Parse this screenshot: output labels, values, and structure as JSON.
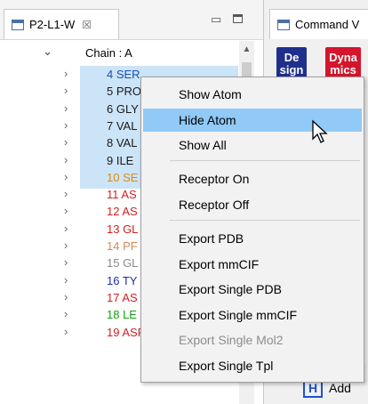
{
  "left_tab": {
    "title": "P2-L1-W",
    "close": "☒"
  },
  "right_tab": {
    "title": "Command V"
  },
  "tree": {
    "chain": "Chain : A",
    "residues": [
      {
        "label": "4 SER",
        "color": "#1a4fb0"
      },
      {
        "label": "5 PRO",
        "color": "#1a1a1a"
      },
      {
        "label": "6 GLY",
        "color": "#1a1a1a"
      },
      {
        "label": "7 VAL",
        "color": "#1a1a1a"
      },
      {
        "label": "8 VAL",
        "color": "#1a1a1a"
      },
      {
        "label": "9 ILE",
        "color": "#1a1a1a"
      },
      {
        "label": "10 SE",
        "color": "#e08a00"
      },
      {
        "label": "11 AS",
        "color": "#d42020"
      },
      {
        "label": "12 AS",
        "color": "#d42020"
      },
      {
        "label": "13 GL",
        "color": "#d42020"
      },
      {
        "label": "14 PF",
        "color": "#d28a55"
      },
      {
        "label": "15 GL",
        "color": "#8a8a8a"
      },
      {
        "label": "16 TY",
        "color": "#2030a0"
      },
      {
        "label": "17 AS",
        "color": "#d42020"
      },
      {
        "label": "18 LE",
        "color": "#16a016"
      },
      {
        "label": "19 ASP",
        "color": "#d42020"
      }
    ]
  },
  "buttons": {
    "design": "De sign",
    "dynamics": "Dyna mics"
  },
  "add_row": {
    "icon": "H",
    "label": "Add"
  },
  "context_menu": {
    "items": [
      {
        "label": "Show Atom",
        "state": "normal"
      },
      {
        "label": "Hide Atom",
        "state": "hover"
      },
      {
        "label": "Show All",
        "state": "normal"
      },
      {
        "label": "Receptor On",
        "state": "normal"
      },
      {
        "label": "Receptor Off",
        "state": "normal"
      },
      {
        "label": "Export PDB",
        "state": "normal"
      },
      {
        "label": "Export mmCIF",
        "state": "normal"
      },
      {
        "label": "Export Single PDB",
        "state": "normal"
      },
      {
        "label": "Export Single mmCIF",
        "state": "normal"
      },
      {
        "label": "Export Single Mol2",
        "state": "disabled"
      },
      {
        "label": "Export Single Tpl",
        "state": "normal"
      }
    ]
  },
  "colors": {
    "selection": "#cce4f7",
    "menu_hover": "#91c9f7",
    "design": "#1f2f8c",
    "dynamics": "#d3152d"
  }
}
